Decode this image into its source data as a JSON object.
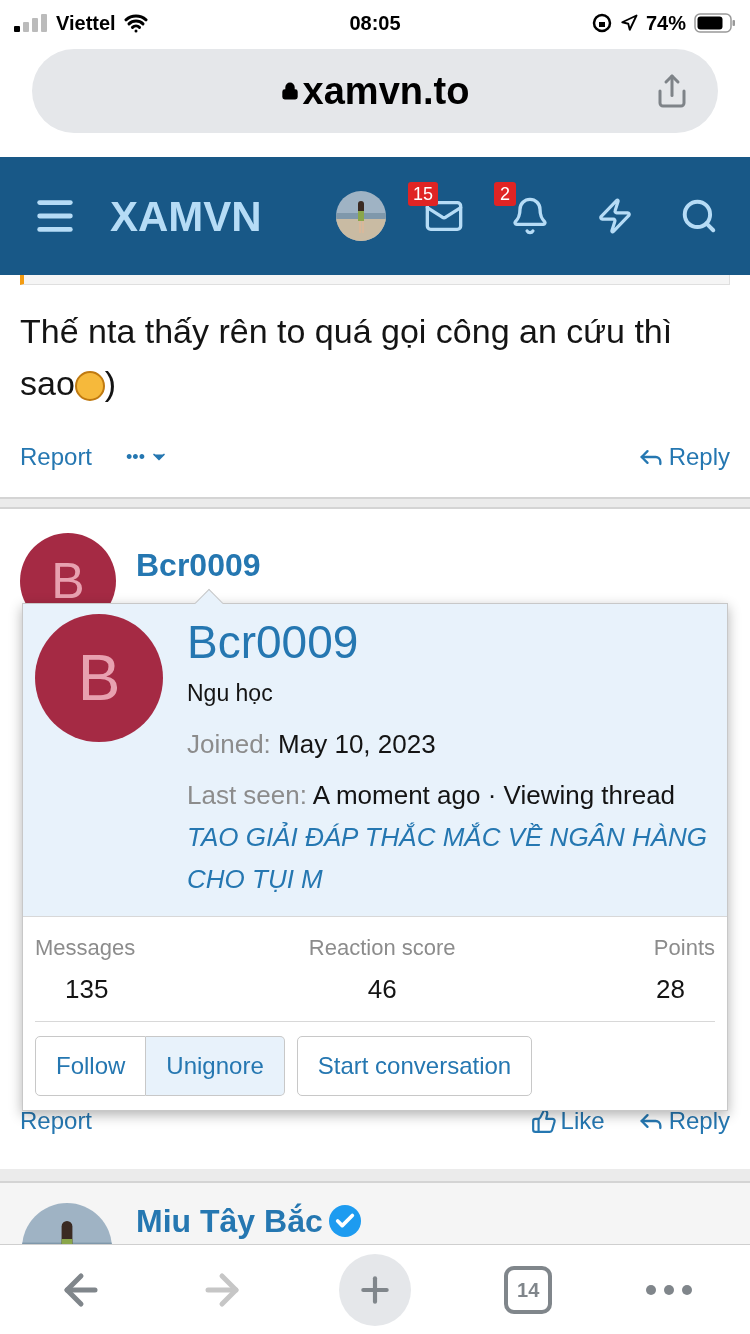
{
  "status_bar": {
    "carrier": "Viettel",
    "time": "08:05",
    "battery": "74%"
  },
  "address_bar": {
    "url": "xamvn.to"
  },
  "nav": {
    "logo": "XAMVN",
    "messages_badge": "15",
    "alerts_badge": "2"
  },
  "post_1": {
    "text": "Thế nta thấy rên to quá gọi công an cứu thì sao",
    "emoji_tail": ")",
    "actions": {
      "report": "Report",
      "more": "•••",
      "reply": "Reply"
    }
  },
  "post_2": {
    "avatar_letter": "B",
    "username": "Bcr0009",
    "actions": {
      "report": "Report",
      "like": "Like",
      "reply": "Reply"
    }
  },
  "member_card": {
    "avatar_letter": "B",
    "username": "Bcr0009",
    "title": "Ngu học",
    "joined_label": "Joined:",
    "joined": "May 10, 2023",
    "last_seen_label": "Last seen:",
    "last_seen": "A moment ago · Viewing thread",
    "thread_link": "TAO GIẢI ĐÁP THẮC MẮC VỀ NGÂN HÀNG CHO TỤI M",
    "stats": [
      {
        "label": "Messages",
        "value": "135"
      },
      {
        "label": "Reaction score",
        "value": "46"
      },
      {
        "label": "Points",
        "value": "28"
      }
    ],
    "buttons": [
      {
        "label": "Follow",
        "selected": false
      },
      {
        "label": "Unignore",
        "selected": true
      },
      {
        "label": "Start conversation",
        "selected": false
      }
    ]
  },
  "post_3": {
    "username": "Miu Tây Bắc",
    "verified": true
  },
  "toolbar": {
    "tab_count": "14"
  }
}
